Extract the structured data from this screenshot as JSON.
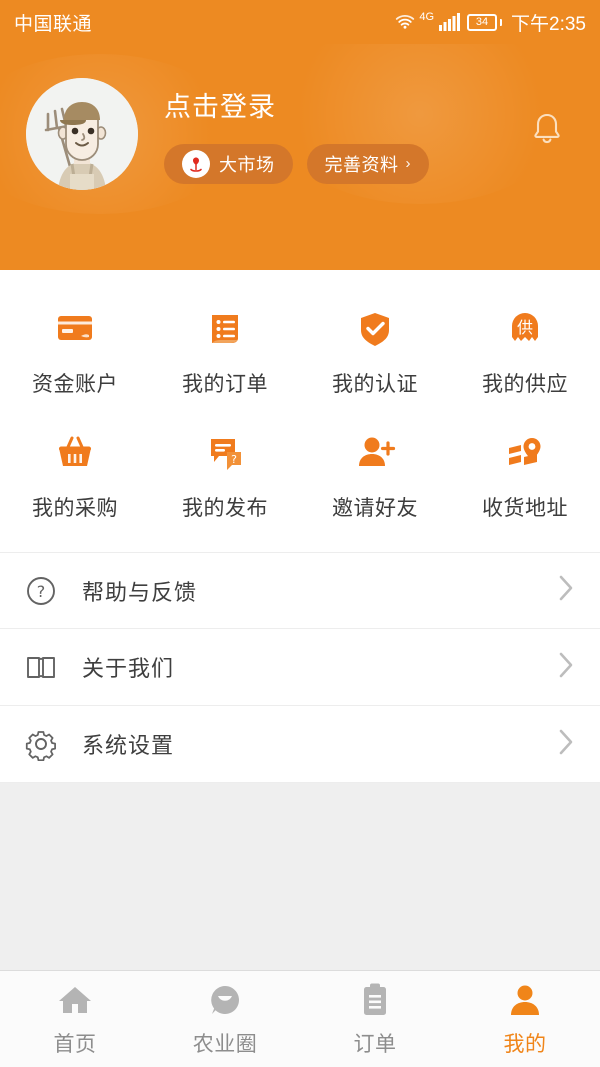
{
  "theme": {
    "brand_orange": "#ED8A22",
    "icon_orange": "#F07B1D",
    "pill_bg": "#D4772A",
    "active_tab": "#F08519",
    "page_bg": "#efefef"
  },
  "status_bar": {
    "carrier": "中国联通",
    "wifi_icon": "wifi-icon",
    "network_type": "4G",
    "signal_icon": "cellular-signal-icon",
    "battery_level": "34",
    "time": "下午2:35"
  },
  "header": {
    "avatar_icon": "farmer-avatar",
    "login_prompt": "点击登录",
    "notification_icon": "bell-icon",
    "pills": [
      {
        "label": "大市场",
        "icon": "market-tulip-logo",
        "chevron": ""
      },
      {
        "label": "完善资料",
        "icon": "",
        "chevron": "›"
      }
    ]
  },
  "grid": {
    "rows": [
      [
        {
          "label": "资金账户",
          "icon": "credit-card-icon"
        },
        {
          "label": "我的订单",
          "icon": "order-list-icon"
        },
        {
          "label": "我的认证",
          "icon": "shield-check-icon"
        },
        {
          "label": "我的供应",
          "icon": "supply-badge-icon"
        }
      ],
      [
        {
          "label": "我的采购",
          "icon": "shopping-basket-icon"
        },
        {
          "label": "我的发布",
          "icon": "chat-question-icon"
        },
        {
          "label": "邀请好友",
          "icon": "person-add-icon"
        },
        {
          "label": "收货地址",
          "icon": "map-pin-icon"
        }
      ]
    ]
  },
  "menu": {
    "items": [
      {
        "label": "帮助与反馈",
        "icon": "question-circle-icon",
        "chevron": "›"
      },
      {
        "label": "关于我们",
        "icon": "open-book-icon",
        "chevron": "›"
      },
      {
        "label": "系统设置",
        "icon": "gear-icon",
        "chevron": "›"
      }
    ]
  },
  "tabbar": {
    "tabs": [
      {
        "label": "首页",
        "icon": "home-icon",
        "active": false
      },
      {
        "label": "农业圈",
        "icon": "community-smile-icon",
        "active": false
      },
      {
        "label": "订单",
        "icon": "clipboard-icon",
        "active": false
      },
      {
        "label": "我的",
        "icon": "person-icon",
        "active": true
      }
    ]
  }
}
